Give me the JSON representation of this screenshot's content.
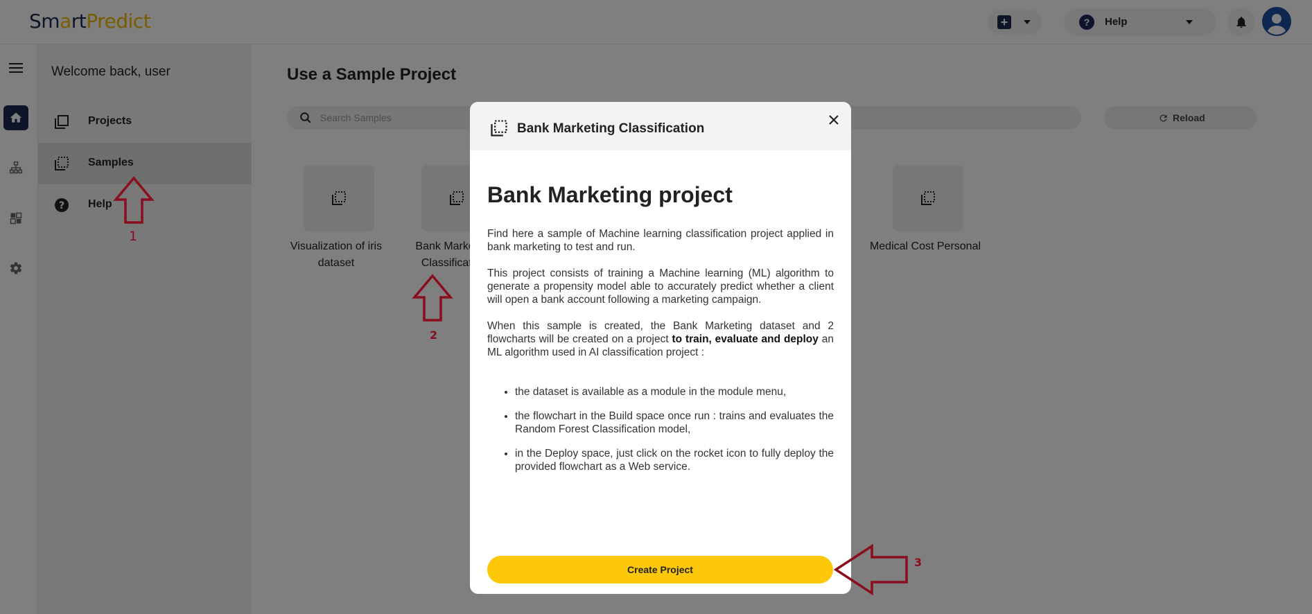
{
  "app": {
    "logo_part1": "Sm",
    "logo_part2": "a",
    "logo_part3": "rt",
    "logo_part4": "Predict",
    "brand_colors": {
      "navy": "#1d2b52",
      "yellow": "#f5b800",
      "button_yellow": "#fdc70a"
    }
  },
  "header": {
    "add_icon": "plus-square-icon",
    "help_label": "Help",
    "bell_icon": "bell-icon",
    "avatar_icon": "user-avatar-icon"
  },
  "rail": {
    "items": [
      {
        "icon": "home-icon",
        "active": true
      },
      {
        "icon": "flowchart-icon",
        "active": false
      },
      {
        "icon": "dashboard-grid-icon",
        "active": false
      },
      {
        "icon": "gear-icon",
        "active": false
      }
    ]
  },
  "sidebar": {
    "welcome": "Welcome back, user",
    "items": [
      {
        "label": "Projects",
        "icon": "projects-icon"
      },
      {
        "label": "Samples",
        "icon": "samples-icon",
        "active": true
      },
      {
        "label": "Help",
        "icon": "help-circle-icon"
      }
    ]
  },
  "main": {
    "title": "Use a Sample Project",
    "search_placeholder": "Search Samples",
    "reload_label": "Reload",
    "cards": [
      {
        "label": "Visualization of iris dataset"
      },
      {
        "label": "Bank Marketing Classification"
      },
      {
        "label": "Medical Cost Personal"
      }
    ]
  },
  "modal": {
    "title": "Bank Marketing Classification",
    "heading": "Bank Marketing project",
    "para1": "Find here a sample of Machine learning classification project applied in bank marketing to test and run.",
    "para2": "This project consists of training a Machine learning (ML) algorithm to generate a propensity model able to accurately predict whether a client will open a bank account following a marketing campaign.",
    "para3_a": "When this sample is created, the Bank Marketing dataset and 2 flowcharts will be created on a project ",
    "para3_bold": "to train, evaluate and deploy",
    "para3_b": " an ML algorithm used in AI classification project :",
    "bullets": [
      "the dataset is available as a module in the module menu,",
      "the flowchart in the Build space once run : trains and evaluates the Random Forest Classification model,",
      "in the Deploy space, just click on the rocket icon to fully deploy the provided flowchart as a Web service."
    ],
    "create_label": "Create Project"
  },
  "annotations": {
    "step1": "1",
    "step2": "2",
    "step3": "3",
    "color": "#8b0e1e"
  }
}
